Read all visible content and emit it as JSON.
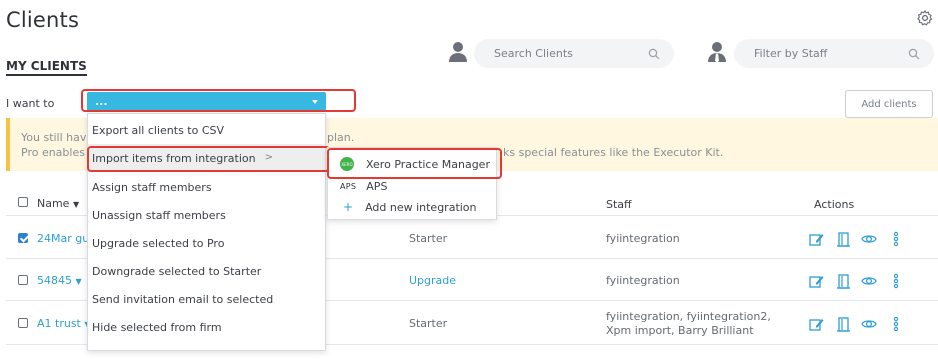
{
  "page": {
    "title": "Clients"
  },
  "section": {
    "title": "MY CLIENTS"
  },
  "search": {
    "placeholder": "Search Clients"
  },
  "filter": {
    "placeholder": "Filter by Staff"
  },
  "bulk": {
    "label": "I want to",
    "selected": "..."
  },
  "add_clients_label": "Add clients",
  "banner": {
    "line1_start": "You still hav",
    "line1_end": "plan.",
    "line2_start": "Pro enables",
    "line2_end": "ks special features like the Executor Kit."
  },
  "table": {
    "headers": {
      "name": "Name",
      "staff": "Staff",
      "actions": "Actions"
    },
    "rows": [
      {
        "name": "24Mar gu",
        "checked": true,
        "plan": "Starter",
        "staff": "fyiintegration"
      },
      {
        "name": "54845",
        "checked": false,
        "plan": "Upgrade",
        "staff": "fyiintegration"
      },
      {
        "name": "A1 trust",
        "checked": false,
        "plan": "Starter",
        "staff": "fyiintegration, fyiintegration2, Xpm import, Barry Brilliant"
      }
    ]
  },
  "menu": {
    "items": [
      "Export all clients to CSV",
      "Import items from integration",
      "Assign staff members",
      "Unassign staff members",
      "Upgrade selected to Pro",
      "Downgrade selected to Starter",
      "Send invitation email to selected",
      "Hide selected from firm"
    ]
  },
  "submenu": {
    "items": [
      {
        "label": "Xero Practice Manager",
        "icon": "xero-logo",
        "logo_text": "XERO"
      },
      {
        "label": "APS",
        "icon": "aps-logo",
        "logo_text": "APS"
      },
      {
        "label": "Add new integration",
        "icon": "plus-icon"
      }
    ]
  },
  "colors": {
    "accent": "#36b8e0",
    "link": "#2e9fd2",
    "highlight": "#e53935",
    "banner_bg": "#fff7e0",
    "banner_border": "#f5c242"
  }
}
